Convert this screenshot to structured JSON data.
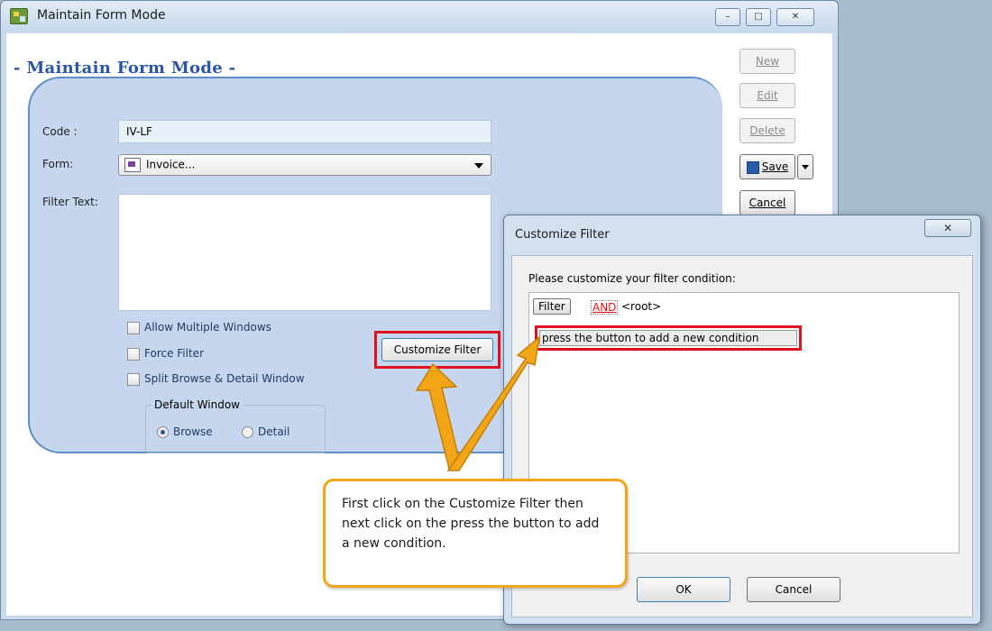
{
  "window": {
    "title": "Maintain Form Mode",
    "minimize": "–",
    "restore": "□",
    "close": "✕"
  },
  "form": {
    "heading": "- Maintain Form Mode -",
    "code_label": "Code :",
    "code_value": "IV-LF",
    "form_label": "Form:",
    "form_value": "Invoice...",
    "filter_text_label": "Filter Text:",
    "checkboxes": [
      "Allow Multiple Windows",
      "Force Filter",
      "Split Browse & Detail Window"
    ],
    "default_window_label": "Default Window",
    "radio_browse": "Browse",
    "radio_detail": "Detail",
    "customize_filter": "Customize Filter"
  },
  "side_buttons": {
    "new": "New",
    "edit": "Edit",
    "delete": "Delete",
    "save": "Save",
    "cancel": "Cancel"
  },
  "dialog": {
    "title": "Customize Filter",
    "close": "✕",
    "prompt": "Please customize your filter condition:",
    "filter_btn": "Filter",
    "and_tag": "AND",
    "root": "<root>",
    "add_condition": "press the button to add a new condition",
    "ok": "OK",
    "cancel": "Cancel"
  },
  "callout": {
    "text": "First click on the Customize Filter then next click on the press the button to add a new condition."
  },
  "colors": {
    "accent": "#2957a4",
    "panel": "#c5d6ee",
    "highlight": "#e0101c",
    "callout": "#f2a516"
  }
}
